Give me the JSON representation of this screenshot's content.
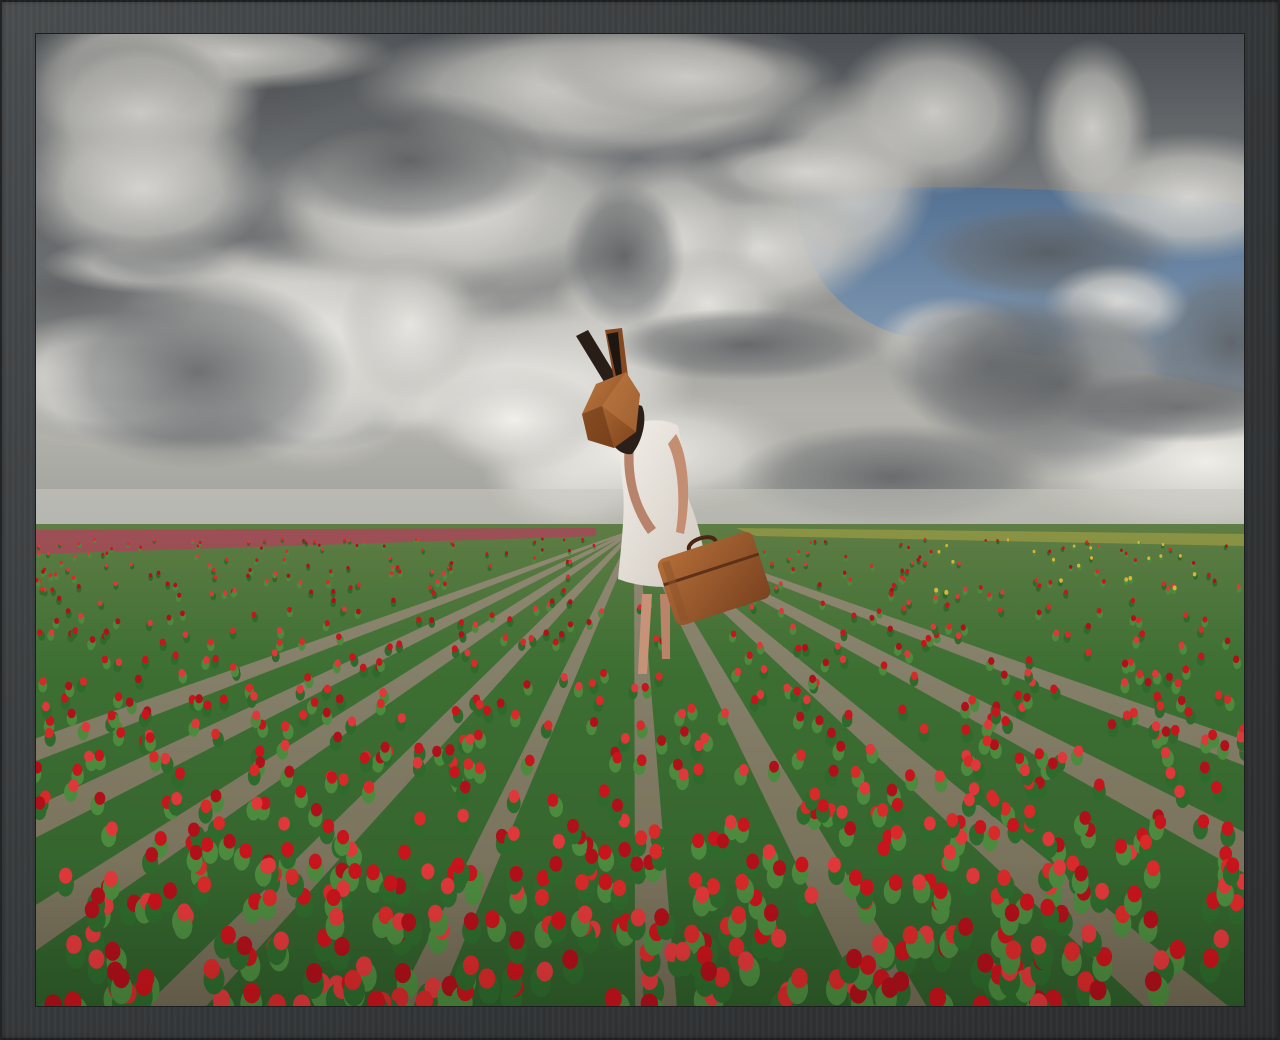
{
  "artwork": {
    "subject": "person-with-rabbit-mask-in-tulip-field",
    "colors": {
      "frame": "#3a3d3f",
      "sky_top": "#5d636a",
      "sky_blue": "#6f8aa8",
      "cloud_light": "#dcdcd8",
      "cloud_dark": "#6b6e70",
      "field_green": "#3f7a3a",
      "tulip_red": "#c8141c",
      "soil": "#8a7a6a",
      "mask_brown": "#a65e2e",
      "suitcase_brown": "#9b5a2c",
      "dress_white": "#e9e4de"
    }
  }
}
